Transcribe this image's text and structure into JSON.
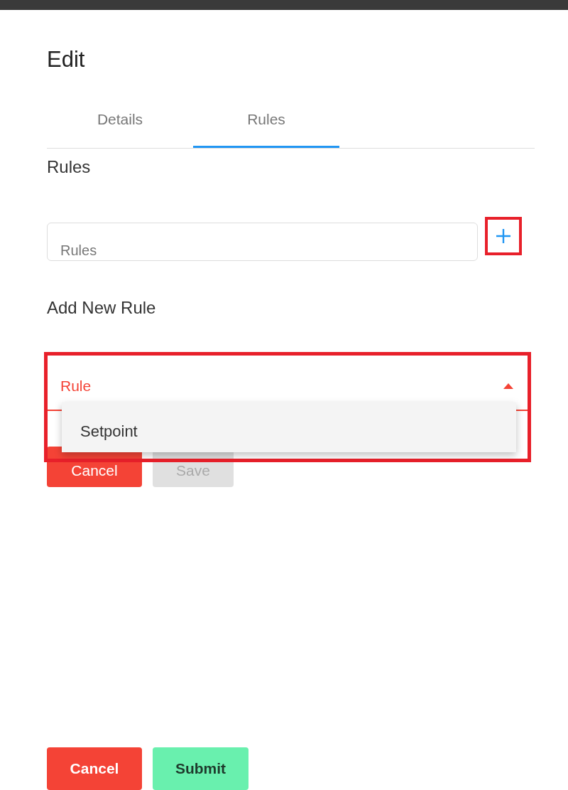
{
  "dialog": {
    "title": "Edit"
  },
  "tabs": [
    {
      "label": "Details",
      "selected": false
    },
    {
      "label": "Rules",
      "selected": true
    }
  ],
  "rules_section": {
    "heading": "Rules",
    "field": {
      "placeholder": "Rules"
    },
    "add_button": {
      "highlighted": true
    }
  },
  "new_rule": {
    "heading": "Add New Rule",
    "select": {
      "label": "Rule",
      "expanded": true,
      "highlighted": true,
      "options": [
        {
          "label": "Setpoint"
        }
      ]
    },
    "buttons": [
      {
        "label": "Cancel",
        "kind": "danger"
      },
      {
        "label": "Save",
        "kind": "disabled"
      }
    ]
  },
  "footer": {
    "buttons": [
      {
        "label": "Cancel",
        "kind": "danger"
      },
      {
        "label": "Submit",
        "kind": "success"
      }
    ]
  }
}
